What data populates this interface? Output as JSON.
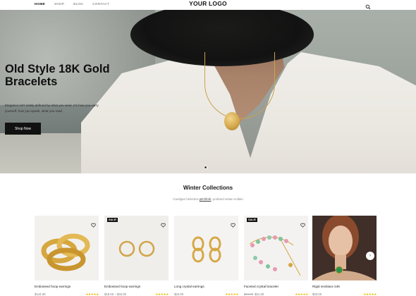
{
  "header": {
    "nav": [
      {
        "label": "HOME",
        "active": true
      },
      {
        "label": "SHOP",
        "active": false
      },
      {
        "label": "BLOG",
        "active": false
      },
      {
        "label": "CONTACT",
        "active": false
      }
    ],
    "logo": "YOUR LOGO",
    "search_icon": "search-icon"
  },
  "hero": {
    "title": "Old Style 18K Gold Bracelets",
    "subtitle": "Elegance isn't solely defined by what you wear. It's how you carry yourself, how you speak, what you read.",
    "button": "Shop Now"
  },
  "collection": {
    "title": "Winter Collections",
    "subtitle_pre": "Cardigan helvetica ",
    "subtitle_link": "pitchfork",
    "subtitle_post": ", portland seitan nullam",
    "products": [
      {
        "name": "Embossed hoop earrings",
        "price": "$144.00",
        "old_price": "",
        "badge": "",
        "rating": 5
      },
      {
        "name": "Embossed hoop earrings",
        "price": "$18.00 – $32.00",
        "old_price": "",
        "badge": "SALE!",
        "rating": 5
      },
      {
        "name": "Long crystal earrings",
        "price": "$34.00",
        "old_price": "",
        "badge": "",
        "rating": 5
      },
      {
        "name": "Faceted crystal bracelet",
        "price": "$21.00",
        "old_price": "$24.00",
        "badge": "SALE!",
        "rating": 5
      },
      {
        "name": "Rigid necklace 24K",
        "price": "$33.00",
        "old_price": "",
        "badge": "",
        "rating": 5
      }
    ]
  },
  "colors": {
    "accent": "#111111",
    "stars": "#f0b400",
    "gold": "#d5a94d"
  }
}
